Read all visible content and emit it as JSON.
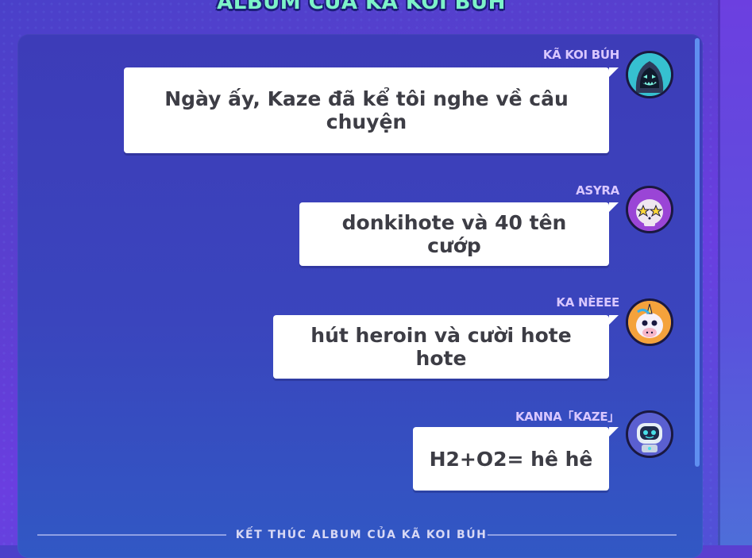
{
  "album": {
    "title": "ALBUM CỦA KÃ KOI BÚH",
    "footer": "KẾT THÚC ALBUM CỦA KÃ KOI BÚH"
  },
  "messages": [
    {
      "sender": "KÃ KOI BÚH",
      "text": "Ngày ấy, Kaze đã kể tôi nghe về câu chuyện",
      "avatar_icon": "hooded-ghost-avatar-icon"
    },
    {
      "sender": "ASYRA",
      "text": "donkihote và 40 tên cướp",
      "avatar_icon": "star-eyes-skull-avatar-icon"
    },
    {
      "sender": "KA NÈEEE",
      "text": "hút heroin và cười hote hote",
      "avatar_icon": "unicorn-avatar-icon"
    },
    {
      "sender": "KANNA「KAZE」",
      "text": "H2+O2= hê hê",
      "avatar_icon": "robot-avatar-icon"
    }
  ],
  "colors": {
    "title_text": "#7df3c8",
    "sender_text": "#d9c7ff",
    "bubble_bg": "#ffffff",
    "scrollbar": "#5f8ff0"
  }
}
